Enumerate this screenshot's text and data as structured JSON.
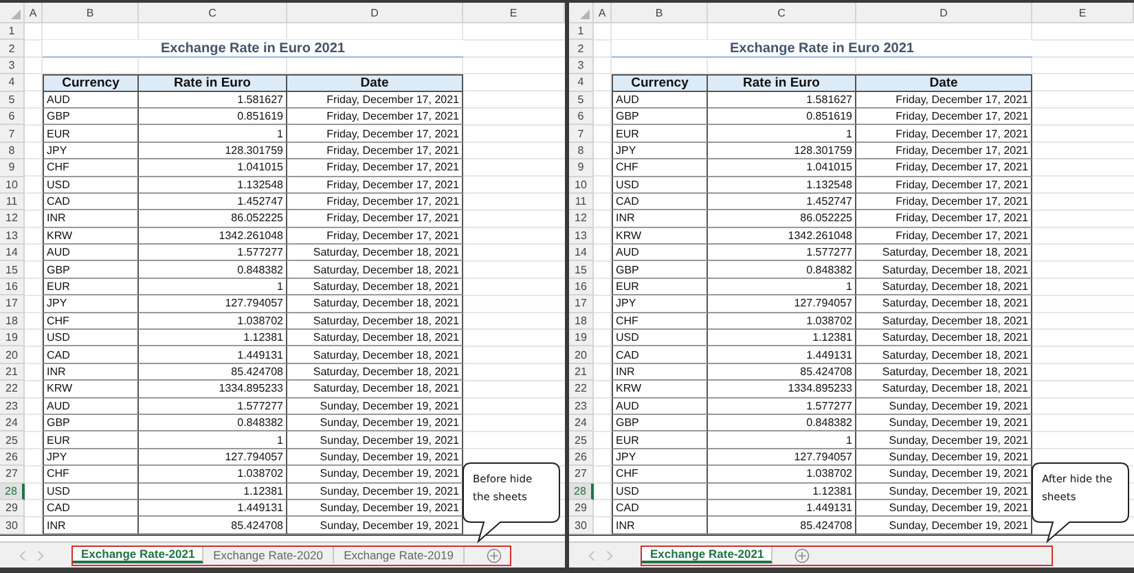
{
  "panes": [
    {
      "columns": [
        "A",
        "B",
        "C",
        "D",
        "E"
      ],
      "row_headers": [
        {
          "label": "1",
          "selected": false
        },
        {
          "label": "2",
          "selected": false
        },
        {
          "label": "3",
          "selected": false
        },
        {
          "label": "4",
          "selected": false
        },
        {
          "label": "5",
          "selected": false
        },
        {
          "label": "6",
          "selected": false
        },
        {
          "label": "7",
          "selected": false
        },
        {
          "label": "8",
          "selected": false
        },
        {
          "label": "9",
          "selected": false
        },
        {
          "label": "10",
          "selected": false
        },
        {
          "label": "11",
          "selected": false
        },
        {
          "label": "12",
          "selected": false
        },
        {
          "label": "13",
          "selected": false
        },
        {
          "label": "14",
          "selected": false
        },
        {
          "label": "15",
          "selected": false
        },
        {
          "label": "16",
          "selected": false
        },
        {
          "label": "17",
          "selected": false
        },
        {
          "label": "18",
          "selected": false
        },
        {
          "label": "19",
          "selected": false
        },
        {
          "label": "20",
          "selected": false
        },
        {
          "label": "21",
          "selected": false
        },
        {
          "label": "22",
          "selected": false
        },
        {
          "label": "23",
          "selected": false
        },
        {
          "label": "24",
          "selected": false
        },
        {
          "label": "25",
          "selected": false
        },
        {
          "label": "26",
          "selected": false
        },
        {
          "label": "27",
          "selected": false
        },
        {
          "label": "28",
          "selected": true
        },
        {
          "label": "29",
          "selected": false
        },
        {
          "label": "30",
          "selected": false
        }
      ],
      "title": "Exchange Rate in Euro 2021",
      "headers": [
        "Currency",
        "Rate in Euro",
        "Date"
      ],
      "rows": [
        {
          "currency": "AUD",
          "rate": "1.581627",
          "date": "Friday, December 17, 2021"
        },
        {
          "currency": "GBP",
          "rate": "0.851619",
          "date": "Friday, December 17, 2021"
        },
        {
          "currency": "EUR",
          "rate": "1",
          "date": "Friday, December 17, 2021"
        },
        {
          "currency": "JPY",
          "rate": "128.301759",
          "date": "Friday, December 17, 2021"
        },
        {
          "currency": "CHF",
          "rate": "1.041015",
          "date": "Friday, December 17, 2021"
        },
        {
          "currency": "USD",
          "rate": "1.132548",
          "date": "Friday, December 17, 2021"
        },
        {
          "currency": "CAD",
          "rate": "1.452747",
          "date": "Friday, December 17, 2021"
        },
        {
          "currency": "INR",
          "rate": "86.052225",
          "date": "Friday, December 17, 2021"
        },
        {
          "currency": "KRW",
          "rate": "1342.261048",
          "date": "Friday, December 17, 2021"
        },
        {
          "currency": "AUD",
          "rate": "1.577277",
          "date": "Saturday, December 18, 2021"
        },
        {
          "currency": "GBP",
          "rate": "0.848382",
          "date": "Saturday, December 18, 2021"
        },
        {
          "currency": "EUR",
          "rate": "1",
          "date": "Saturday, December 18, 2021"
        },
        {
          "currency": "JPY",
          "rate": "127.794057",
          "date": "Saturday, December 18, 2021"
        },
        {
          "currency": "CHF",
          "rate": "1.038702",
          "date": "Saturday, December 18, 2021"
        },
        {
          "currency": "USD",
          "rate": "1.12381",
          "date": "Saturday, December 18, 2021"
        },
        {
          "currency": "CAD",
          "rate": "1.449131",
          "date": "Saturday, December 18, 2021"
        },
        {
          "currency": "INR",
          "rate": "85.424708",
          "date": "Saturday, December 18, 2021"
        },
        {
          "currency": "KRW",
          "rate": "1334.895233",
          "date": "Saturday, December 18, 2021"
        },
        {
          "currency": "AUD",
          "rate": "1.577277",
          "date": "Sunday, December 19, 2021"
        },
        {
          "currency": "GBP",
          "rate": "0.848382",
          "date": "Sunday, December 19, 2021"
        },
        {
          "currency": "EUR",
          "rate": "1",
          "date": "Sunday, December 19, 2021"
        },
        {
          "currency": "JPY",
          "rate": "127.794057",
          "date": "Sunday, December 19, 2021"
        },
        {
          "currency": "CHF",
          "rate": "1.038702",
          "date": "Sunday, December 19, 2021"
        },
        {
          "currency": "USD",
          "rate": "1.12381",
          "date": "Sunday, December 19, 2021"
        },
        {
          "currency": "CAD",
          "rate": "1.449131",
          "date": "Sunday, December 19, 2021"
        },
        {
          "currency": "INR",
          "rate": "85.424708",
          "date": "Sunday, December 19, 2021"
        }
      ],
      "sheet_tabs": [
        {
          "label": "Exchange Rate-2021",
          "selected": true
        },
        {
          "label": "Exchange Rate-2020",
          "selected": false
        },
        {
          "label": "Exchange Rate-2019",
          "selected": false
        }
      ],
      "callout": "Before hide the sheets"
    },
    {
      "columns": [
        "A",
        "B",
        "C",
        "D",
        "E"
      ],
      "row_headers": [
        {
          "label": "1",
          "selected": false
        },
        {
          "label": "2",
          "selected": false
        },
        {
          "label": "3",
          "selected": false
        },
        {
          "label": "4",
          "selected": false
        },
        {
          "label": "5",
          "selected": false
        },
        {
          "label": "6",
          "selected": false
        },
        {
          "label": "7",
          "selected": false
        },
        {
          "label": "8",
          "selected": false
        },
        {
          "label": "9",
          "selected": false
        },
        {
          "label": "10",
          "selected": false
        },
        {
          "label": "11",
          "selected": false
        },
        {
          "label": "12",
          "selected": false
        },
        {
          "label": "13",
          "selected": false
        },
        {
          "label": "14",
          "selected": false
        },
        {
          "label": "15",
          "selected": false
        },
        {
          "label": "16",
          "selected": false
        },
        {
          "label": "17",
          "selected": false
        },
        {
          "label": "18",
          "selected": false
        },
        {
          "label": "19",
          "selected": false
        },
        {
          "label": "20",
          "selected": false
        },
        {
          "label": "21",
          "selected": false
        },
        {
          "label": "22",
          "selected": false
        },
        {
          "label": "23",
          "selected": false
        },
        {
          "label": "24",
          "selected": false
        },
        {
          "label": "25",
          "selected": false
        },
        {
          "label": "26",
          "selected": false
        },
        {
          "label": "27",
          "selected": false
        },
        {
          "label": "28",
          "selected": true
        },
        {
          "label": "29",
          "selected": false
        },
        {
          "label": "30",
          "selected": false
        }
      ],
      "title": "Exchange Rate in Euro 2021",
      "headers": [
        "Currency",
        "Rate in Euro",
        "Date"
      ],
      "rows": [
        {
          "currency": "AUD",
          "rate": "1.581627",
          "date": "Friday, December 17, 2021"
        },
        {
          "currency": "GBP",
          "rate": "0.851619",
          "date": "Friday, December 17, 2021"
        },
        {
          "currency": "EUR",
          "rate": "1",
          "date": "Friday, December 17, 2021"
        },
        {
          "currency": "JPY",
          "rate": "128.301759",
          "date": "Friday, December 17, 2021"
        },
        {
          "currency": "CHF",
          "rate": "1.041015",
          "date": "Friday, December 17, 2021"
        },
        {
          "currency": "USD",
          "rate": "1.132548",
          "date": "Friday, December 17, 2021"
        },
        {
          "currency": "CAD",
          "rate": "1.452747",
          "date": "Friday, December 17, 2021"
        },
        {
          "currency": "INR",
          "rate": "86.052225",
          "date": "Friday, December 17, 2021"
        },
        {
          "currency": "KRW",
          "rate": "1342.261048",
          "date": "Friday, December 17, 2021"
        },
        {
          "currency": "AUD",
          "rate": "1.577277",
          "date": "Saturday, December 18, 2021"
        },
        {
          "currency": "GBP",
          "rate": "0.848382",
          "date": "Saturday, December 18, 2021"
        },
        {
          "currency": "EUR",
          "rate": "1",
          "date": "Saturday, December 18, 2021"
        },
        {
          "currency": "JPY",
          "rate": "127.794057",
          "date": "Saturday, December 18, 2021"
        },
        {
          "currency": "CHF",
          "rate": "1.038702",
          "date": "Saturday, December 18, 2021"
        },
        {
          "currency": "USD",
          "rate": "1.12381",
          "date": "Saturday, December 18, 2021"
        },
        {
          "currency": "CAD",
          "rate": "1.449131",
          "date": "Saturday, December 18, 2021"
        },
        {
          "currency": "INR",
          "rate": "85.424708",
          "date": "Saturday, December 18, 2021"
        },
        {
          "currency": "KRW",
          "rate": "1334.895233",
          "date": "Saturday, December 18, 2021"
        },
        {
          "currency": "AUD",
          "rate": "1.577277",
          "date": "Sunday, December 19, 2021"
        },
        {
          "currency": "GBP",
          "rate": "0.848382",
          "date": "Sunday, December 19, 2021"
        },
        {
          "currency": "EUR",
          "rate": "1",
          "date": "Sunday, December 19, 2021"
        },
        {
          "currency": "JPY",
          "rate": "127.794057",
          "date": "Sunday, December 19, 2021"
        },
        {
          "currency": "CHF",
          "rate": "1.038702",
          "date": "Sunday, December 19, 2021"
        },
        {
          "currency": "USD",
          "rate": "1.12381",
          "date": "Sunday, December 19, 2021"
        },
        {
          "currency": "CAD",
          "rate": "1.449131",
          "date": "Sunday, December 19, 2021"
        },
        {
          "currency": "INR",
          "rate": "85.424708",
          "date": "Sunday, December 19, 2021"
        }
      ],
      "sheet_tabs": [
        {
          "label": "Exchange Rate-2021",
          "selected": true
        }
      ],
      "callout": "After hide the sheets"
    }
  ]
}
